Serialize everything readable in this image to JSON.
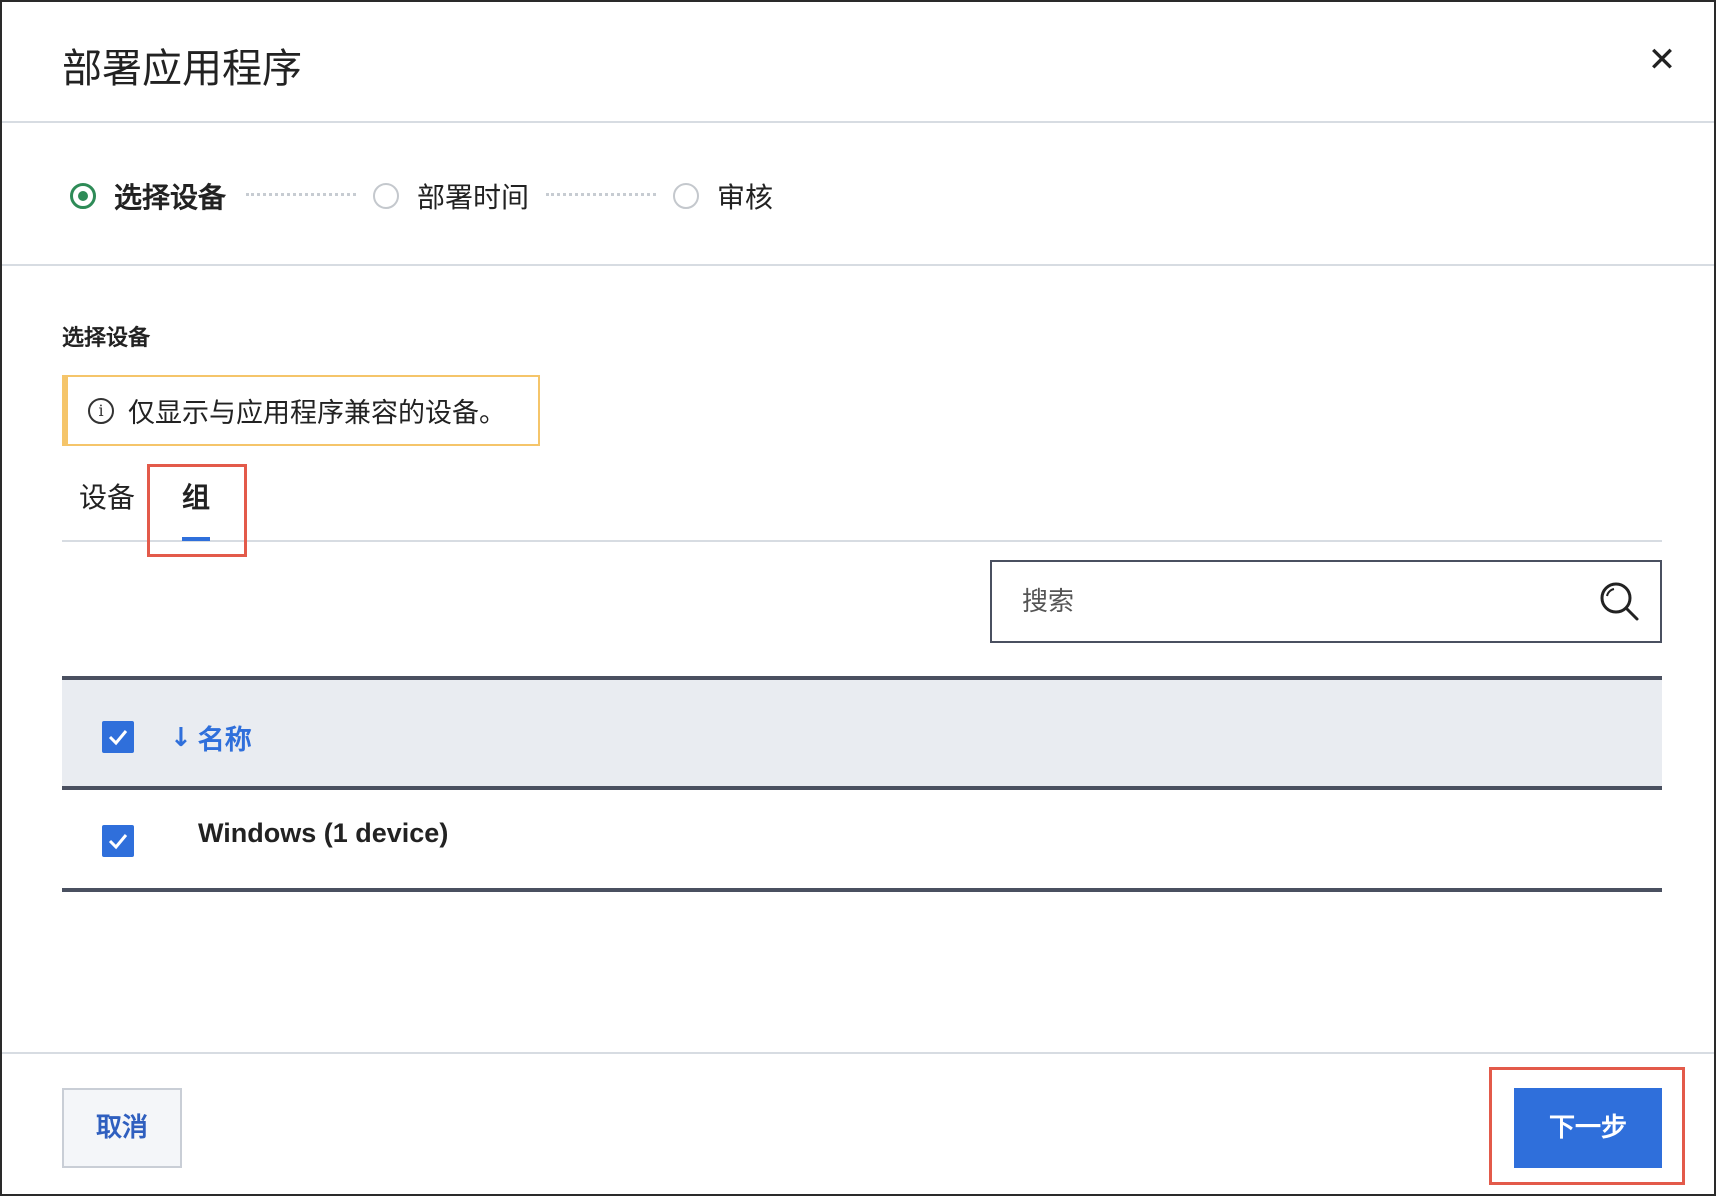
{
  "dialog": {
    "title": "部署应用程序",
    "close_icon": "close-icon"
  },
  "stepper": {
    "steps": [
      {
        "label": "选择设备",
        "state": "active"
      },
      {
        "label": "部署时间",
        "state": "pending"
      },
      {
        "label": "审核",
        "state": "pending"
      }
    ]
  },
  "section": {
    "label": "选择设备",
    "notice": "仅显示与应用程序兼容的设备。"
  },
  "tabs": [
    {
      "label": "设备",
      "selected": false
    },
    {
      "label": "组",
      "selected": true
    }
  ],
  "search": {
    "placeholder": "搜索",
    "value": ""
  },
  "table": {
    "header": {
      "sort_arrow": "↓",
      "column": "名称",
      "checked": true
    },
    "rows": [
      {
        "name": "Windows (1 device)",
        "checked": true
      }
    ]
  },
  "footer": {
    "cancel_label": "取消",
    "next_label": "下一步"
  },
  "colors": {
    "primary": "#2f6fdb",
    "step_active": "#2e8b57",
    "notice_border": "#f5c56a",
    "highlight": "#e35a4a"
  }
}
